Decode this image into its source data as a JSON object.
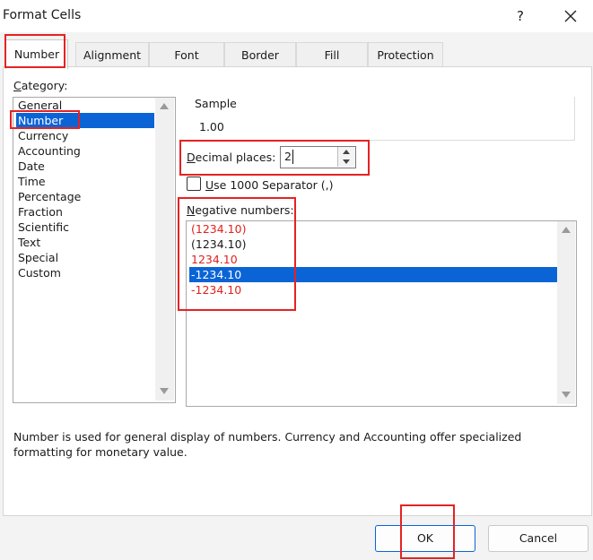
{
  "window": {
    "title": "Format Cells",
    "help": "?",
    "close_icon": "close-icon"
  },
  "tabs": [
    {
      "label": "Number",
      "active": true
    },
    {
      "label": "Alignment"
    },
    {
      "label": "Font"
    },
    {
      "label": "Border"
    },
    {
      "label": "Fill"
    },
    {
      "label": "Protection"
    }
  ],
  "category": {
    "label_first": "C",
    "label_rest": "ategory:",
    "items": [
      "General",
      "Number",
      "Currency",
      "Accounting",
      "Date",
      "Time",
      "Percentage",
      "Fraction",
      "Scientific",
      "Text",
      "Special",
      "Custom"
    ],
    "selected": "Number"
  },
  "sample": {
    "label": "Sample",
    "value": "1.00"
  },
  "decimal_places": {
    "label_first": "D",
    "label_rest": "ecimal places:",
    "value": "2"
  },
  "separator": {
    "label_first": "U",
    "label_rest": "se 1000 Separator (,)",
    "checked": false
  },
  "negative_numbers": {
    "label_first": "N",
    "label_rest": "egative numbers:",
    "items": [
      {
        "text": "(1234.10)",
        "color": "#e0211d"
      },
      {
        "text": "(1234.10)",
        "color": "#1a1a1a"
      },
      {
        "text": "1234.10",
        "color": "#e0211d"
      },
      {
        "text": "-1234.10",
        "color": "#ffffff"
      },
      {
        "text": "-1234.10",
        "color": "#e0211d"
      }
    ],
    "selected_index": 3
  },
  "description": "Number is used for general display of numbers.  Currency and Accounting offer specialized formatting for monetary value.",
  "buttons": {
    "ok": "OK",
    "cancel": "Cancel"
  },
  "colors": {
    "highlight": "#e52222",
    "selection": "#0a64d6",
    "negative_red": "#e0211d"
  }
}
